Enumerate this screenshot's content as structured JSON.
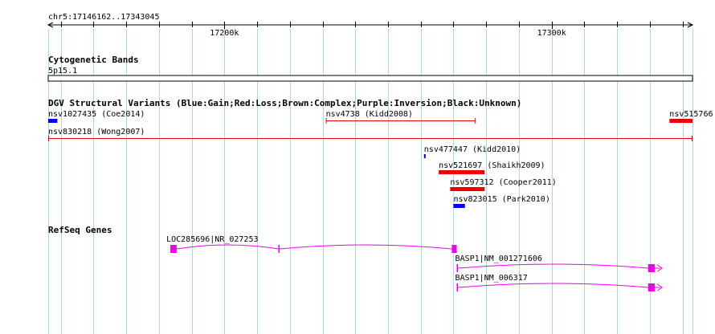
{
  "location": "chr5:17146162..17343045",
  "ruler": {
    "start": 17146162,
    "end": 17343045,
    "ticks": [
      17200000,
      17300000
    ],
    "tick_labels": [
      "17200k",
      "17300k"
    ]
  },
  "colors": {
    "grid": "#a6d8f2",
    "gain": "#0000ee",
    "loss": "#ee0000",
    "gene": "#ee00ee",
    "line": "#000000"
  },
  "cytoband": {
    "title": "Cytogenetic Bands",
    "band": "5p15.1"
  },
  "dgv": {
    "title": "DGV Structural Variants (Blue:Gain;Red:Loss;Brown:Complex;Purple:Inversion;Black:Unknown)",
    "features": [
      {
        "label": "nsv1027435 (Coe2014)",
        "type": "gain",
        "style": "box",
        "start": 17146162,
        "end": 17148950,
        "row": 0,
        "label_pos": "right"
      },
      {
        "label": "nsv4738 (Kidd2008)",
        "type": "loss",
        "style": "line",
        "start": 17231000,
        "end": 17276800,
        "row": 0,
        "label_pos": "right"
      },
      {
        "label": "nsv515766",
        "type": "loss",
        "style": "box",
        "start": 17336000,
        "end": 17343045,
        "row": 0,
        "label_pos": "right"
      },
      {
        "label": "nsv830218 (Wong2007)",
        "type": "loss",
        "style": "line",
        "start": 17146162,
        "end": 17343045,
        "row": 1,
        "label_pos": "right"
      },
      {
        "label": "nsv477447 (Kidd2010)",
        "type": "gain",
        "style": "box",
        "start": 17261000,
        "end": 17261500,
        "row": 2,
        "label_pos": "right"
      },
      {
        "label": "nsv521697 (Shaikh2009)",
        "type": "loss",
        "style": "box",
        "start": 17265500,
        "end": 17279500,
        "row": 3,
        "label_pos": "right"
      },
      {
        "label": "nsv597312 (Cooper2011)",
        "type": "loss",
        "style": "box",
        "start": 17269000,
        "end": 17279500,
        "row": 4,
        "label_pos": "right"
      },
      {
        "label": "nsv823015 (Park2010)",
        "type": "gain",
        "style": "box",
        "start": 17270000,
        "end": 17273500,
        "row": 5,
        "label_pos": "right"
      }
    ]
  },
  "refseq": {
    "title": "RefSeq Genes",
    "genes": [
      {
        "label": "LOC285696|NR_027253",
        "start": 17183500,
        "end": 17271000,
        "strand": "-",
        "exons": [
          [
            17183500,
            17185400
          ],
          [
            17216500,
            17216800
          ],
          [
            17269500,
            17271000
          ]
        ]
      },
      {
        "label": "BASP1|NM_001271606",
        "start": 17271000,
        "end": 17331800,
        "strand": "+",
        "exons": [
          [
            17271000,
            17271400
          ],
          [
            17329500,
            17331500
          ]
        ]
      },
      {
        "label": "BASP1|NM_006317",
        "start": 17271000,
        "end": 17331800,
        "strand": "+",
        "exons": [
          [
            17271000,
            17271400
          ],
          [
            17329500,
            17331500
          ]
        ]
      }
    ]
  }
}
